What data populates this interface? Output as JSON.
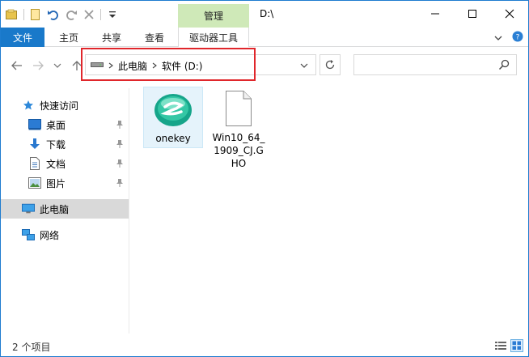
{
  "titlebar": {
    "contextual_tab": "管理",
    "title": "D:\\"
  },
  "ribbon": {
    "tabs": [
      "文件",
      "主页",
      "共享",
      "查看"
    ],
    "contextual": "驱动器工具"
  },
  "address": {
    "crumbs": [
      "此电脑",
      "软件 (D:)"
    ]
  },
  "sidebar": {
    "quick_access": "快速访问",
    "items": [
      "桌面",
      "下载",
      "文档",
      "图片"
    ],
    "this_pc": "此电脑",
    "network": "网络"
  },
  "files": [
    {
      "name": "onekey",
      "icon": "onekey-app-icon"
    },
    {
      "name": "Win10_64_1909_CJ.GHO",
      "icon": "blank-file-icon"
    }
  ],
  "status": {
    "count_text": "2 个项目"
  },
  "colors": {
    "accent": "#1979ca",
    "manage_tab": "#cfe9b8",
    "highlight": "#e0262b",
    "selection": "#d9d9d9"
  }
}
